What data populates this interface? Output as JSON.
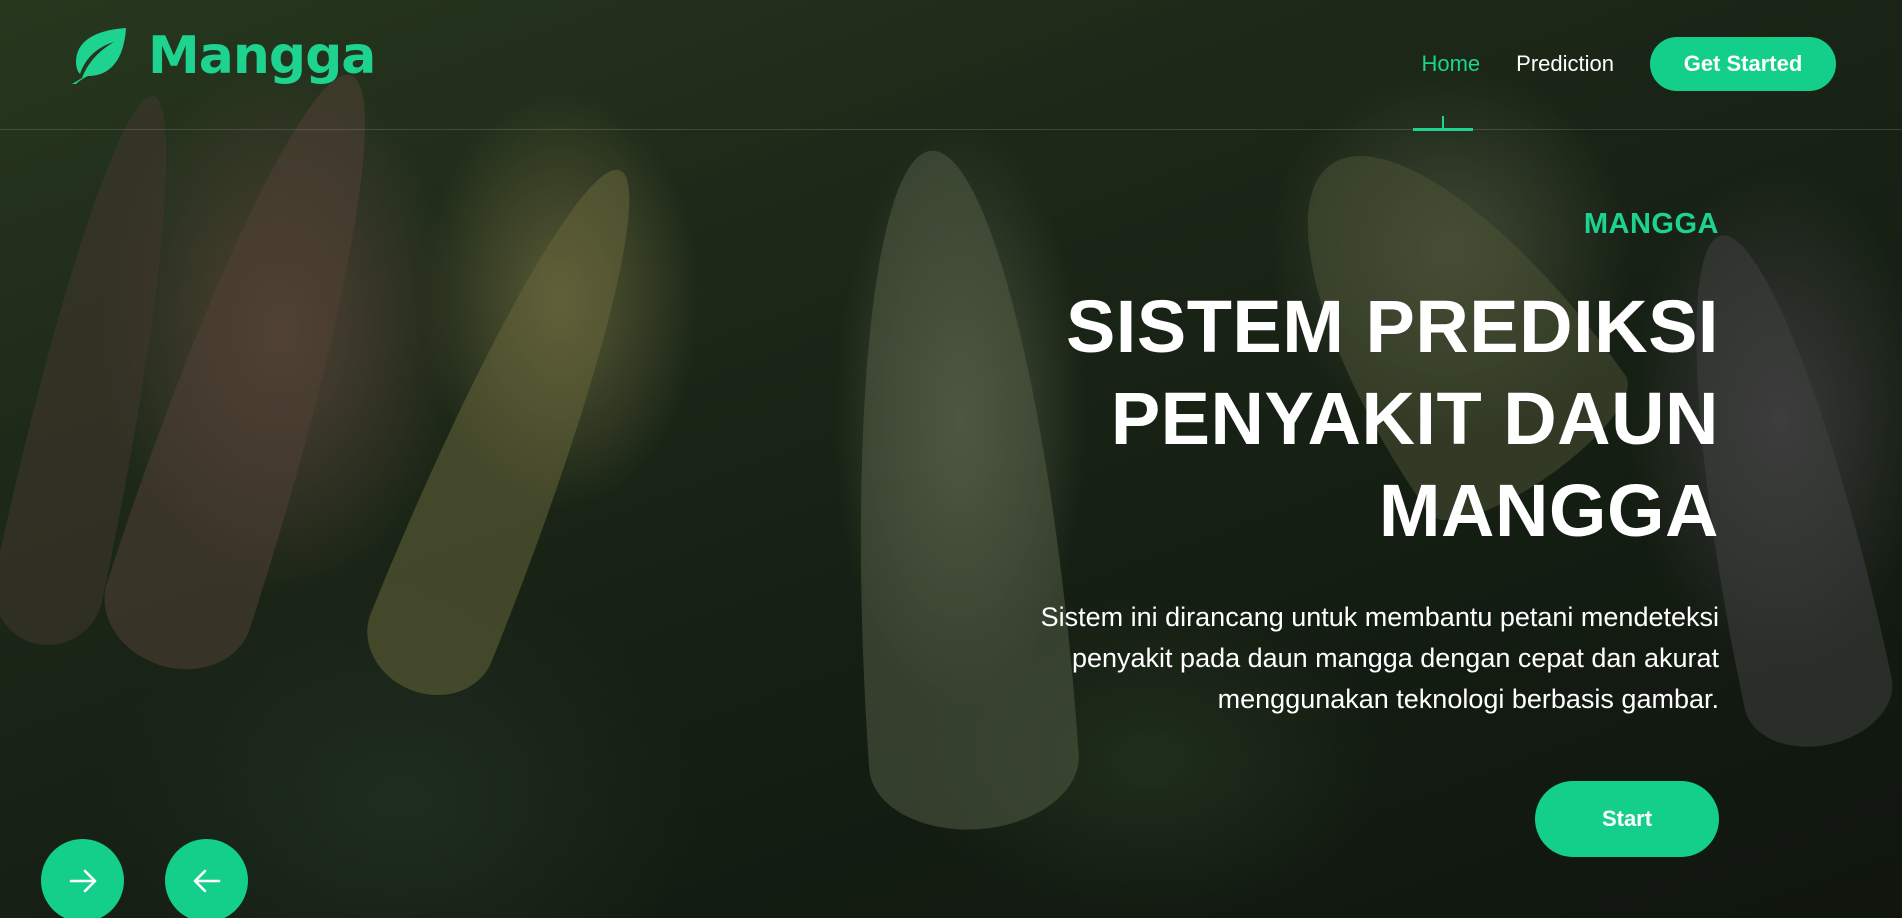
{
  "brand": {
    "name": "Mangga",
    "icon": "leaf-icon"
  },
  "nav": {
    "items": [
      {
        "label": "Home",
        "active": true
      },
      {
        "label": "Prediction",
        "active": false
      }
    ],
    "cta_label": "Get Started"
  },
  "hero": {
    "eyebrow": "MANGGA",
    "title_lines": [
      "SISTEM PREDIKSI",
      "PENYAKIT DAUN",
      "MANGGA"
    ],
    "description": "Sistem ini dirancang untuk membantu petani mendeteksi penyakit pada daun mangga dengan cepat dan akurat menggunakan teknologi berbasis gambar.",
    "start_label": "Start"
  },
  "carousel": {
    "next_icon": "arrow-right-icon",
    "prev_icon": "arrow-left-icon"
  },
  "colors": {
    "accent": "#14cf8a",
    "text": "#ffffff"
  }
}
